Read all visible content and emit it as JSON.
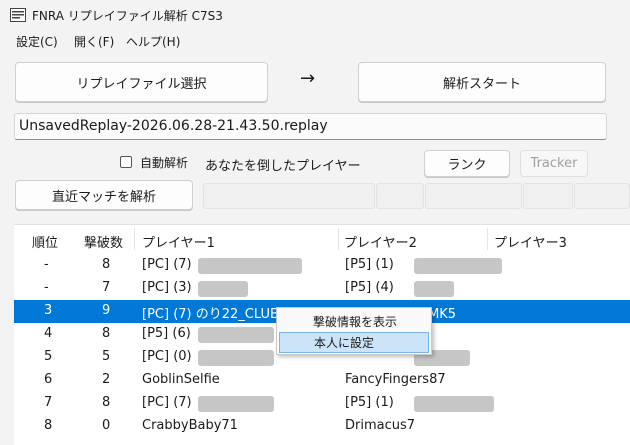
{
  "window": {
    "title": "FNRA リプレイファイル解析 C7S3"
  },
  "menu": {
    "settings": "設定(C)",
    "open": "開く(F)",
    "help": "ヘルプ(H)"
  },
  "toolbar": {
    "select_file": "リプレイファイル選択",
    "arrow": "→",
    "start_analysis": "解析スタート",
    "file_path": "UnsavedReplay-2026.06.28-21.43.50.replay",
    "auto_analysis": "自動解析",
    "auto_analysis_checked": false,
    "killed_by_label": "あなたを倒したプレイヤー",
    "rank_button": "ランク",
    "tracker_button": "Tracker",
    "analyze_recent": "直近マッチを解析"
  },
  "table": {
    "headers": [
      "順位",
      "撃破数",
      "プレイヤー1",
      "プレイヤー2",
      "プレイヤー3"
    ],
    "rows": [
      {
        "rank": "-",
        "kills": "8",
        "p1": "[PC] (7)",
        "p2": "[P5] (1)",
        "selected": false
      },
      {
        "rank": "-",
        "kills": "7",
        "p1": "[PC] (3)",
        "p2": "[P5] (4)",
        "selected": false
      },
      {
        "rank": "3",
        "kills": "9",
        "p1": "[PC] (7) のり22_CLUB014",
        "p2": "[P5] (2) れん MK5",
        "selected": true
      },
      {
        "rank": "4",
        "kills": "8",
        "p1": "[P5] (6)",
        "p2": "",
        "selected": false
      },
      {
        "rank": "5",
        "kills": "5",
        "p1": "[PC] (0)",
        "p2": "",
        "selected": false
      },
      {
        "rank": "6",
        "kills": "2",
        "p1": "GoblinSelfie",
        "p2": "FancyFingers87",
        "selected": false
      },
      {
        "rank": "7",
        "kills": "8",
        "p1": "[PC] (7)",
        "p2": "[P5] (1)",
        "selected": false
      },
      {
        "rank": "8",
        "kills": "0",
        "p1": "CrabbyBaby71",
        "p2": "Drimacus7",
        "selected": false
      }
    ]
  },
  "context_menu": {
    "show_kill_info": "撃破情報を表示",
    "set_as_self": "本人に設定"
  },
  "colors": {
    "selection": "#0078d7",
    "menu_highlight": "#cce4f7"
  }
}
